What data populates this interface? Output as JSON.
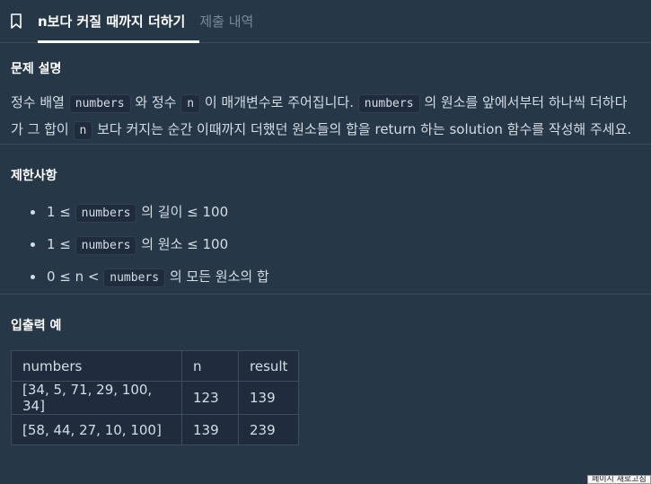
{
  "tabs": {
    "active_label": "n보다 커질 때까지 더하기",
    "inactive_label": "제출 내역"
  },
  "description": {
    "title": "문제 설명",
    "line1": {
      "t1": "정수 배열 ",
      "c1": "numbers",
      "t2": " 와 정수 ",
      "c2": "n",
      "t3": " 이 매개변수로 주어집니다. ",
      "c3": "numbers",
      "t4": " 의 원소를 앞에서부터 하나씩 더하다"
    },
    "line2": {
      "t1": "가 그 합이 ",
      "c1": "n",
      "t2": " 보다 커지는 순간 이때까지 더했던 원소들의 합을 return 하는 solution 함수를 작성해 주세요."
    }
  },
  "limits": {
    "title": "제한사항",
    "items": [
      {
        "pre": "1 ≤ ",
        "code": "numbers",
        "post": " 의 길이 ≤ 100"
      },
      {
        "pre": "1 ≤ ",
        "code": "numbers",
        "post": " 의 원소 ≤ 100"
      },
      {
        "pre": "0 ≤ n < ",
        "code": "numbers",
        "post": " 의 모든 원소의 합"
      }
    ]
  },
  "examples": {
    "title": "입출력 예",
    "headers": [
      "numbers",
      "n",
      "result"
    ],
    "rows": [
      [
        "[34, 5, 71, 29, 100, 34]",
        "123",
        "139"
      ],
      [
        "[58, 44, 27, 10, 100]",
        "139",
        "239"
      ]
    ]
  },
  "tooltip": "페이지 새로고침"
}
